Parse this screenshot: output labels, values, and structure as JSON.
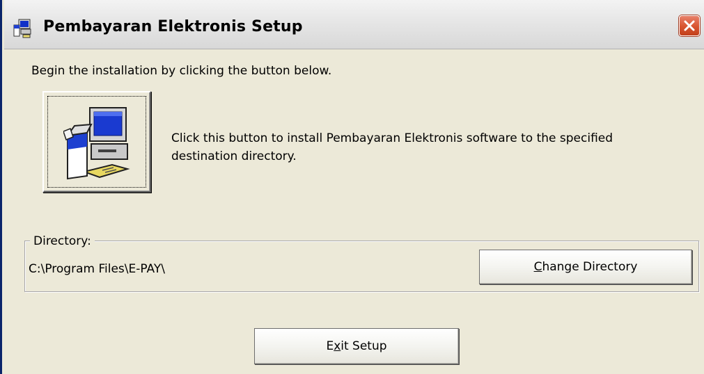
{
  "window": {
    "title": "Pembayaran Elektronis Setup",
    "title_icon": "setup-computer-icon",
    "close_icon": "close-icon"
  },
  "main": {
    "intro_text": "Begin the installation by clicking the button below.",
    "install_button_icon": "setup-computer-icon",
    "install_description": "Click this button to install Pembayaran Elektronis software to the specified destination directory."
  },
  "directory": {
    "group_label": "Directory:",
    "path": "C:\\Program Files\\E-PAY\\",
    "change_button": {
      "mnemonic": "C",
      "rest": "hange Directory"
    }
  },
  "footer": {
    "exit_button": {
      "before": "E",
      "mnemonic": "x",
      "after": "it Setup"
    }
  },
  "colors": {
    "dialog_bg": "#ece9d8",
    "close_button": "#d8542f"
  }
}
